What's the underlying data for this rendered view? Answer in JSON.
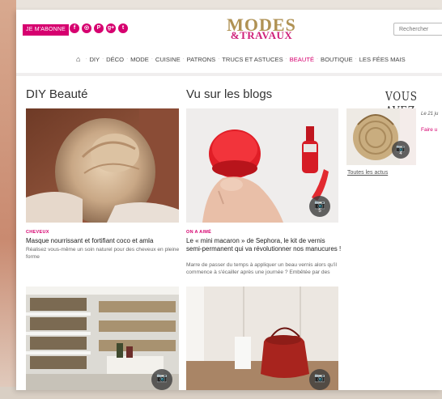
{
  "header": {
    "subscribe_label": "JE M'ABONNE",
    "socials": [
      {
        "icon": "facebook-icon",
        "glyph": "f"
      },
      {
        "icon": "instagram-icon",
        "glyph": "◎"
      },
      {
        "icon": "pinterest-icon",
        "glyph": "P"
      },
      {
        "icon": "googleplus-icon",
        "glyph": "g+"
      },
      {
        "icon": "twitter-icon",
        "glyph": "t"
      }
    ],
    "logo_line1": "MODES",
    "logo_line2": "&TRAVAUX",
    "search_placeholder": "Rechercher"
  },
  "nav": {
    "home_icon": "home-icon",
    "items": [
      "DIY",
      "DÉCO",
      "MODE",
      "CUISINE",
      "PATRONS",
      "TRUCS ET ASTUCES",
      "BEAUTÉ",
      "BOUTIQUE",
      "LES FÉES MAIS"
    ],
    "active": "BEAUTÉ"
  },
  "sections": {
    "diy_title": "DIY Beauté",
    "blogs_title": "Vu sur les blogs",
    "vous_avez": "VOUS AVEZ"
  },
  "articles": {
    "a1": {
      "tag": "CHEVEUX",
      "title": "Masque nourrissant et fortifiant coco et amla",
      "desc": "Réalisez vous-même un soin naturel pour des cheveux en pleine forme"
    },
    "a2": {
      "tag": "ON A AIMÉ",
      "title": "Le « mini macaron » de Sephora, le kit de vernis semi-permanent qui va révolutionner nos manucures !",
      "desc": "Marre de passer du temps à appliquer un beau vernis alors qu'il commence à s'écailler après une journée ? Embêtée par des",
      "photo_count": "5"
    }
  },
  "sidebar": {
    "photo_count": "4",
    "date": "Le 21 ju",
    "link": "Faire u",
    "all_news": "Toutes les actus"
  },
  "colors": {
    "accent": "#d6006f",
    "logo_gold": "#b09254"
  }
}
